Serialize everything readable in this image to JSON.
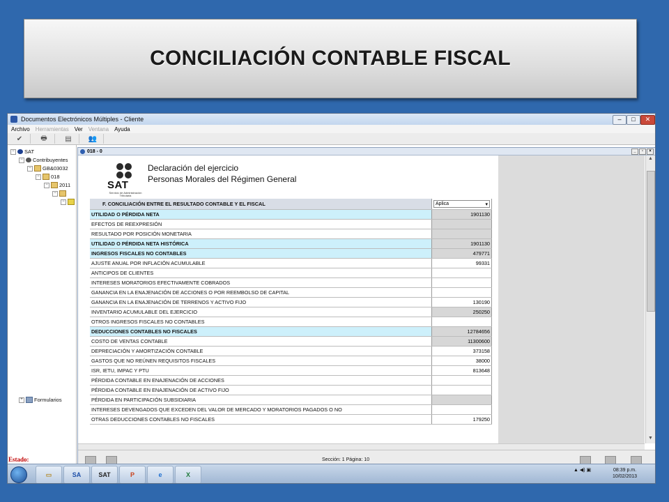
{
  "slide": {
    "title": "CONCILIACIÓN CONTABLE FISCAL"
  },
  "window": {
    "title": "Documentos Electrónicos Múltiples - Cliente",
    "controls": {
      "minimize": "–",
      "maximize": "□",
      "close": "✕"
    }
  },
  "menu": {
    "items": [
      {
        "label": "Archivo",
        "enabled": true
      },
      {
        "label": "Herramientas",
        "enabled": false
      },
      {
        "label": "Ver",
        "enabled": true
      },
      {
        "label": "Ventana",
        "enabled": false
      },
      {
        "label": "Ayuda",
        "enabled": true
      }
    ]
  },
  "toolbar": {
    "icons": [
      "check-icon",
      "print-icon",
      "form-icon",
      "people-icon"
    ],
    "glyphs": [
      "✔",
      "🖶",
      "▤",
      "👥"
    ]
  },
  "tree": {
    "root": "SAT",
    "contribuyentes": "Contribuyentes",
    "rfc": "GB&03032",
    "folder_018": "018",
    "folder_year": "2011",
    "folder_sub": "",
    "formularios": "Formularios"
  },
  "document": {
    "tab_title": "018 - 0",
    "heading": "Declaración del ejercicio",
    "subheading": "Personas Morales del Régimen General",
    "logo": {
      "word": "SAT",
      "sub": "Servicio de Administración Tributaria"
    },
    "section": {
      "title": "F. CONCILIACIÓN ENTRE EL RESULTADO CONTABLE Y EL FISCAL",
      "dropdown_value": "Aplica"
    },
    "rows": [
      {
        "label": "UTILIDAD O PÉRDIDA NETA",
        "value": "1901130",
        "style": "cyan",
        "cell": "gray"
      },
      {
        "label": "EFECTOS DE REEXPRESIÓN",
        "value": "",
        "style": "normal",
        "cell": "gray"
      },
      {
        "label": "RESULTADO POR POSICIÓN MONETARIA",
        "value": "",
        "style": "normal",
        "cell": "gray"
      },
      {
        "label": "UTILIDAD O PÉRDIDA NETA HISTÓRICA",
        "value": "1901130",
        "style": "cyan",
        "cell": "gray"
      },
      {
        "label": "INGRESOS FISCALES NO CONTABLES",
        "value": "479771",
        "style": "cyan",
        "cell": "gray"
      },
      {
        "label": "AJUSTE ANUAL POR INFLACIÓN ACUMULABLE",
        "value": "99331",
        "style": "normal",
        "cell": "white"
      },
      {
        "label": "ANTICIPOS DE CLIENTES",
        "value": "",
        "style": "normal",
        "cell": "white"
      },
      {
        "label": "INTERESES MORATORIOS EFECTIVAMENTE COBRADOS",
        "value": "",
        "style": "normal",
        "cell": "white"
      },
      {
        "label": "GANANCIA EN LA ENAJENACIÓN DE ACCIONES O POR REEMBOLSO DE CAPITAL",
        "value": "",
        "style": "normal",
        "cell": "white"
      },
      {
        "label": "GANANCIA EN LA ENAJENACIÓN DE TERRENOS Y ACTIVO FIJO",
        "value": "130190",
        "style": "normal",
        "cell": "white"
      },
      {
        "label": "INVENTARIO ACUMULABLE DEL EJERCICIO",
        "value": "250250",
        "style": "normal",
        "cell": "gray"
      },
      {
        "label": "OTROS INGRESOS FISCALES NO CONTABLES",
        "value": "",
        "style": "normal",
        "cell": "white"
      },
      {
        "label": "DEDUCCIONES CONTABLES NO FISCALES",
        "value": "12784656",
        "style": "cyan",
        "cell": "gray"
      },
      {
        "label": "COSTO DE VENTAS CONTABLE",
        "value": "11300600",
        "style": "normal",
        "cell": "gray"
      },
      {
        "label": "DEPRECIACIÓN Y AMORTIZACIÓN CONTABLE",
        "value": "373158",
        "style": "normal",
        "cell": "white"
      },
      {
        "label": "GASTOS QUE NO REÚNEN REQUISITOS FISCALES",
        "value": "38000",
        "style": "normal",
        "cell": "white"
      },
      {
        "label": "ISR, IETU, IMPAC Y PTU",
        "value": "813648",
        "style": "normal",
        "cell": "white"
      },
      {
        "label": "PÉRDIDA CONTABLE EN ENAJENACIÓN DE ACCIONES",
        "value": "",
        "style": "normal",
        "cell": "white"
      },
      {
        "label": "PÉRDIDA CONTABLE EN ENAJENACIÓN DE ACTIVO FIJO",
        "value": "",
        "style": "normal",
        "cell": "white"
      },
      {
        "label": "PÉRDIDA EN PARTICIPACIÓN SUBSIDIARIA",
        "value": "",
        "style": "normal",
        "cell": "gray"
      },
      {
        "label": "INTERESES DEVENGADOS QUE EXCEDEN DEL VALOR DE MERCADO Y MORATORIOS PAGADOS O NO",
        "value": "",
        "style": "normal",
        "cell": "white"
      },
      {
        "label": "OTRAS DEDUCCIONES CONTABLES NO FISCALES",
        "value": "179250",
        "style": "normal",
        "cell": "white"
      }
    ]
  },
  "doc_status": {
    "page_info": "Sección: 1  Página: 10"
  },
  "app_status": {
    "label": "Estado:"
  },
  "taskbar": {
    "apps": [
      "explorer",
      "sat-app",
      "sat",
      "powerpoint",
      "internet-explorer",
      "excel"
    ],
    "app_labels": [
      "▭",
      "SA",
      "SAT",
      "P",
      "e",
      "X"
    ],
    "tray_icons": "▲ ◀) ▣",
    "time": "08:39 p.m.",
    "date": "10/02/2013"
  },
  "colors": {
    "slide_bg": "#2f68ad",
    "cyan_row": "#cdf0fb",
    "gray_cell": "#d7d7d7",
    "estado": "#c00000"
  }
}
